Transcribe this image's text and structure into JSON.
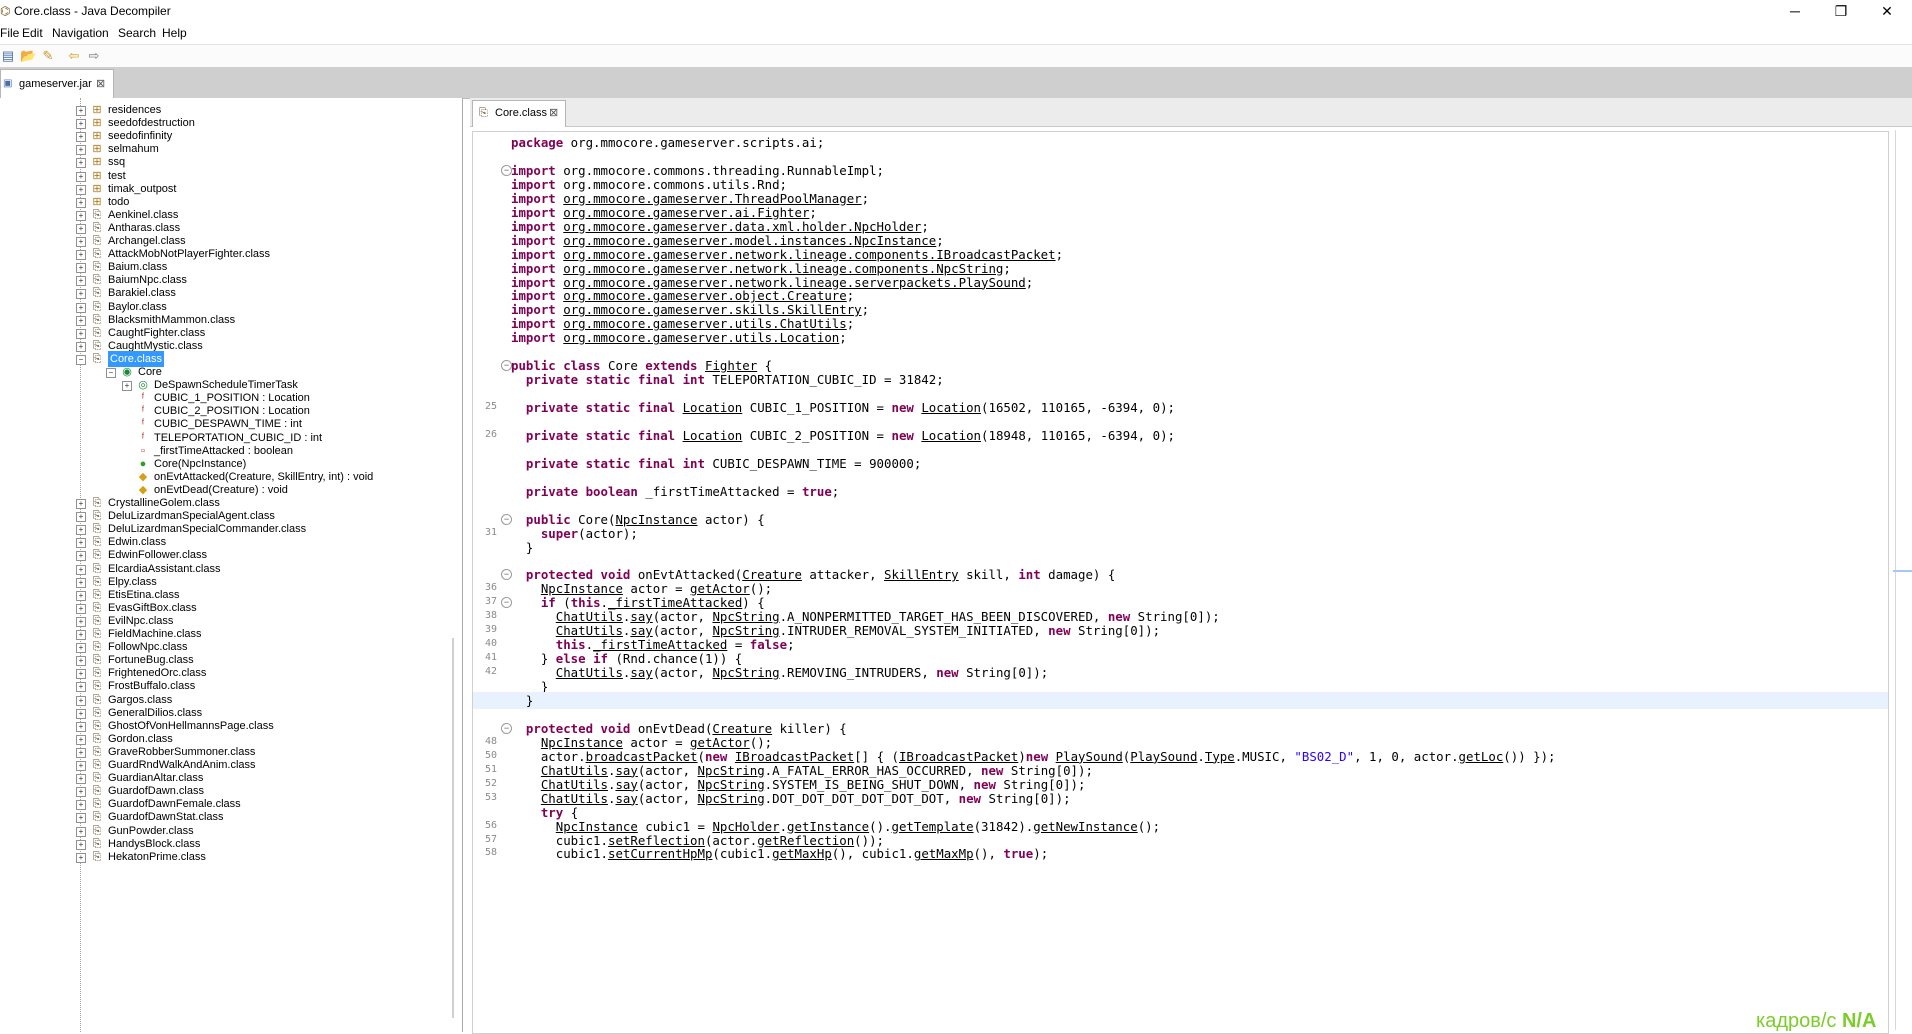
{
  "window": {
    "title": "Core.class - Java Decompiler",
    "controls": {
      "minimize": "─",
      "maximize": "❐",
      "close": "✕"
    }
  },
  "menu": [
    "File",
    "Edit",
    "Navigation",
    "Search",
    "Help"
  ],
  "toolbar": {
    "icons": [
      "open-file-icon",
      "open-type-icon",
      "reference-icon",
      "back-icon",
      "forward-icon"
    ],
    "glyphs": [
      "▤",
      "📂",
      "✎",
      "⇦",
      "⇨"
    ]
  },
  "jar_tab": {
    "label": "gameserver.jar",
    "close": "⊠"
  },
  "tree": {
    "items": [
      {
        "label": "residences",
        "type": "package",
        "depth": 0,
        "expander": "+"
      },
      {
        "label": "seedofdestruction",
        "type": "package",
        "depth": 0,
        "expander": "+"
      },
      {
        "label": "seedofinfinity",
        "type": "package",
        "depth": 0,
        "expander": "+"
      },
      {
        "label": "selmahum",
        "type": "package",
        "depth": 0,
        "expander": "+"
      },
      {
        "label": "ssq",
        "type": "package",
        "depth": 0,
        "expander": "+"
      },
      {
        "label": "test",
        "type": "package",
        "depth": 0,
        "expander": "+"
      },
      {
        "label": "timak_outpost",
        "type": "package",
        "depth": 0,
        "expander": "+"
      },
      {
        "label": "todo",
        "type": "package",
        "depth": 0,
        "expander": "+"
      },
      {
        "label": "Aenkinel.class",
        "type": "class",
        "depth": 0,
        "expander": "+"
      },
      {
        "label": "Antharas.class",
        "type": "class",
        "depth": 0,
        "expander": "+"
      },
      {
        "label": "Archangel.class",
        "type": "class",
        "depth": 0,
        "expander": "+"
      },
      {
        "label": "AttackMobNotPlayerFighter.class",
        "type": "class",
        "depth": 0,
        "expander": "+"
      },
      {
        "label": "Baium.class",
        "type": "class",
        "depth": 0,
        "expander": "+"
      },
      {
        "label": "BaiumNpc.class",
        "type": "class",
        "depth": 0,
        "expander": "+"
      },
      {
        "label": "Barakiel.class",
        "type": "class",
        "depth": 0,
        "expander": "+"
      },
      {
        "label": "Baylor.class",
        "type": "class",
        "depth": 0,
        "expander": "+"
      },
      {
        "label": "BlacksmithMammon.class",
        "type": "class",
        "depth": 0,
        "expander": "+"
      },
      {
        "label": "CaughtFighter.class",
        "type": "class",
        "depth": 0,
        "expander": "+"
      },
      {
        "label": "CaughtMystic.class",
        "type": "class",
        "depth": 0,
        "expander": "+"
      },
      {
        "label": "Core.class",
        "type": "class",
        "depth": 0,
        "expander": "−",
        "selected": true
      },
      {
        "label": "Core",
        "type": "type",
        "depth": 1,
        "expander": "−"
      },
      {
        "label": "DeSpawnScheduleTimerTask",
        "type": "inner",
        "depth": 2,
        "expander": "+"
      },
      {
        "label": "CUBIC_1_POSITION : Location",
        "type": "field-static",
        "depth": 2
      },
      {
        "label": "CUBIC_2_POSITION : Location",
        "type": "field-static",
        "depth": 2
      },
      {
        "label": "CUBIC_DESPAWN_TIME : int",
        "type": "field-static",
        "depth": 2
      },
      {
        "label": "TELEPORTATION_CUBIC_ID : int",
        "type": "field-static",
        "depth": 2
      },
      {
        "label": "_firstTimeAttacked : boolean",
        "type": "field",
        "depth": 2
      },
      {
        "label": "Core(NpcInstance)",
        "type": "ctor",
        "depth": 2
      },
      {
        "label": "onEvtAttacked(Creature, SkillEntry, int) : void",
        "type": "method",
        "depth": 2
      },
      {
        "label": "onEvtDead(Creature) : void",
        "type": "method",
        "depth": 2
      },
      {
        "label": "CrystallineGolem.class",
        "type": "class",
        "depth": 0,
        "expander": "+"
      },
      {
        "label": "DeluLizardmanSpecialAgent.class",
        "type": "class",
        "depth": 0,
        "expander": "+"
      },
      {
        "label": "DeluLizardmanSpecialCommander.class",
        "type": "class",
        "depth": 0,
        "expander": "+"
      },
      {
        "label": "Edwin.class",
        "type": "class",
        "depth": 0,
        "expander": "+"
      },
      {
        "label": "EdwinFollower.class",
        "type": "class",
        "depth": 0,
        "expander": "+"
      },
      {
        "label": "ElcardiaAssistant.class",
        "type": "class",
        "depth": 0,
        "expander": "+"
      },
      {
        "label": "Elpy.class",
        "type": "class",
        "depth": 0,
        "expander": "+"
      },
      {
        "label": "EtisEtina.class",
        "type": "class",
        "depth": 0,
        "expander": "+"
      },
      {
        "label": "EvasGiftBox.class",
        "type": "class",
        "depth": 0,
        "expander": "+"
      },
      {
        "label": "EvilNpc.class",
        "type": "class",
        "depth": 0,
        "expander": "+"
      },
      {
        "label": "FieldMachine.class",
        "type": "class",
        "depth": 0,
        "expander": "+"
      },
      {
        "label": "FollowNpc.class",
        "type": "class",
        "depth": 0,
        "expander": "+"
      },
      {
        "label": "FortuneBug.class",
        "type": "class",
        "depth": 0,
        "expander": "+"
      },
      {
        "label": "FrightenedOrc.class",
        "type": "class",
        "depth": 0,
        "expander": "+"
      },
      {
        "label": "FrostBuffalo.class",
        "type": "class",
        "depth": 0,
        "expander": "+"
      },
      {
        "label": "Gargos.class",
        "type": "class",
        "depth": 0,
        "expander": "+"
      },
      {
        "label": "GeneralDilios.class",
        "type": "class",
        "depth": 0,
        "expander": "+"
      },
      {
        "label": "GhostOfVonHellmannsPage.class",
        "type": "class",
        "depth": 0,
        "expander": "+"
      },
      {
        "label": "Gordon.class",
        "type": "class",
        "depth": 0,
        "expander": "+"
      },
      {
        "label": "GraveRobberSummoner.class",
        "type": "class",
        "depth": 0,
        "expander": "+"
      },
      {
        "label": "GuardRndWalkAndAnim.class",
        "type": "class",
        "depth": 0,
        "expander": "+"
      },
      {
        "label": "GuardianAltar.class",
        "type": "class",
        "depth": 0,
        "expander": "+"
      },
      {
        "label": "GuardofDawn.class",
        "type": "class",
        "depth": 0,
        "expander": "+"
      },
      {
        "label": "GuardofDawnFemale.class",
        "type": "class",
        "depth": 0,
        "expander": "+"
      },
      {
        "label": "GuardofDawnStat.class",
        "type": "class",
        "depth": 0,
        "expander": "+"
      },
      {
        "label": "GunPowder.class",
        "type": "class",
        "depth": 0,
        "expander": "+"
      },
      {
        "label": "HandysBlock.class",
        "type": "class",
        "depth": 0,
        "expander": "+"
      },
      {
        "label": "HekatonPrime.class",
        "type": "class",
        "depth": 0,
        "expander": "+"
      }
    ]
  },
  "editor_tab": {
    "label": "Core.class",
    "close": "⊠"
  },
  "code": {
    "lines": [
      {
        "n": "",
        "fold": "",
        "html": "<span class=\"kw\">package</span> org.mmocore.gameserver.scripts.ai;"
      },
      {
        "n": "",
        "fold": "",
        "html": ""
      },
      {
        "n": "",
        "fold": "−",
        "html": "<span class=\"kw\">import</span> org.mmocore.commons.threading.RunnableImpl;"
      },
      {
        "n": "",
        "fold": "",
        "html": "<span class=\"kw\">import</span> org.mmocore.commons.utils.Rnd;"
      },
      {
        "n": "",
        "fold": "",
        "html": "<span class=\"kw\">import</span> <span class=\"u\">org.mmocore.gameserver.ThreadPoolManager</span>;"
      },
      {
        "n": "",
        "fold": "",
        "html": "<span class=\"kw\">import</span> <span class=\"u\">org.mmocore.gameserver.ai.Fighter</span>;"
      },
      {
        "n": "",
        "fold": "",
        "html": "<span class=\"kw\">import</span> <span class=\"u\">org.mmocore.gameserver.data.xml.holder.NpcHolder</span>;"
      },
      {
        "n": "",
        "fold": "",
        "html": "<span class=\"kw\">import</span> <span class=\"u\">org.mmocore.gameserver.model.instances.NpcInstance</span>;"
      },
      {
        "n": "",
        "fold": "",
        "html": "<span class=\"kw\">import</span> <span class=\"u\">org.mmocore.gameserver.network.lineage.components.IBroadcastPacket</span>;"
      },
      {
        "n": "",
        "fold": "",
        "html": "<span class=\"kw\">import</span> <span class=\"u\">org.mmocore.gameserver.network.lineage.components.NpcString</span>;"
      },
      {
        "n": "",
        "fold": "",
        "html": "<span class=\"kw\">import</span> <span class=\"u\">org.mmocore.gameserver.network.lineage.serverpackets.PlaySound</span>;"
      },
      {
        "n": "",
        "fold": "",
        "html": "<span class=\"kw\">import</span> <span class=\"u\">org.mmocore.gameserver.object.Creature</span>;"
      },
      {
        "n": "",
        "fold": "",
        "html": "<span class=\"kw\">import</span> <span class=\"u\">org.mmocore.gameserver.skills.SkillEntry</span>;"
      },
      {
        "n": "",
        "fold": "",
        "html": "<span class=\"kw\">import</span> <span class=\"u\">org.mmocore.gameserver.utils.ChatUtils</span>;"
      },
      {
        "n": "",
        "fold": "",
        "html": "<span class=\"kw\">import</span> <span class=\"u\">org.mmocore.gameserver.utils.Location</span>;"
      },
      {
        "n": "",
        "fold": "",
        "html": ""
      },
      {
        "n": "",
        "fold": "−",
        "html": "<span class=\"kw\">public class</span> Core <span class=\"kw\">extends</span> <span class=\"u\">Fighter</span> {"
      },
      {
        "n": "",
        "fold": "",
        "html": "  <span class=\"kw\">private static final int</span> TELEPORTATION_CUBIC_ID = 31842;"
      },
      {
        "n": "",
        "fold": "",
        "html": ""
      },
      {
        "n": "25",
        "fold": "",
        "html": "  <span class=\"kw\">private static final</span> <span class=\"u\">Location</span> CUBIC_1_POSITION = <span class=\"kw\">new</span> <span class=\"u\">Location</span>(16502, 110165, -6394, 0);"
      },
      {
        "n": "",
        "fold": "",
        "html": ""
      },
      {
        "n": "26",
        "fold": "",
        "html": "  <span class=\"kw\">private static final</span> <span class=\"u\">Location</span> CUBIC_2_POSITION = <span class=\"kw\">new</span> <span class=\"u\">Location</span>(18948, 110165, -6394, 0);"
      },
      {
        "n": "",
        "fold": "",
        "html": ""
      },
      {
        "n": "",
        "fold": "",
        "html": "  <span class=\"kw\">private static final int</span> CUBIC_DESPAWN_TIME = 900000;"
      },
      {
        "n": "",
        "fold": "",
        "html": ""
      },
      {
        "n": "",
        "fold": "",
        "html": "  <span class=\"kw\">private boolean</span> _firstTimeAttacked = <span class=\"kw\">true</span>;"
      },
      {
        "n": "",
        "fold": "",
        "html": ""
      },
      {
        "n": "",
        "fold": "−",
        "html": "  <span class=\"kw\">public</span> Core(<span class=\"u\">NpcInstance</span> actor) {"
      },
      {
        "n": "31",
        "fold": "",
        "html": "    <span class=\"kw\">super</span>(actor);"
      },
      {
        "n": "",
        "fold": "",
        "html": "  }"
      },
      {
        "n": "",
        "fold": "",
        "html": ""
      },
      {
        "n": "",
        "fold": "−",
        "html": "  <span class=\"kw\">protected void</span> onEvtAttacked(<span class=\"u\">Creature</span> attacker, <span class=\"u\">SkillEntry</span> skill, <span class=\"kw\">int</span> damage) {"
      },
      {
        "n": "36",
        "fold": "",
        "html": "    <span class=\"u\">NpcInstance</span> actor = <span class=\"u\">getActor</span>();"
      },
      {
        "n": "37",
        "fold": "−",
        "html": "    <span class=\"kw\">if</span> (<span class=\"kw\">this</span>.<span class=\"u\">_firstTimeAttacked</span>) {"
      },
      {
        "n": "38",
        "fold": "",
        "html": "      <span class=\"u\">ChatUtils</span>.<span class=\"u\">say</span>(actor, <span class=\"u\">NpcString</span>.A_NONPERMITTED_TARGET_HAS_BEEN_DISCOVERED, <span class=\"kw\">new</span> String[0]);"
      },
      {
        "n": "39",
        "fold": "",
        "html": "      <span class=\"u\">ChatUtils</span>.<span class=\"u\">say</span>(actor, <span class=\"u\">NpcString</span>.INTRUDER_REMOVAL_SYSTEM_INITIATED, <span class=\"kw\">new</span> String[0]);"
      },
      {
        "n": "40",
        "fold": "",
        "html": "      <span class=\"kw\">this</span>.<span class=\"u\">_firstTimeAttacked</span> = <span class=\"kw\">false</span>;"
      },
      {
        "n": "41",
        "fold": "",
        "html": "    } <span class=\"kw\">else if</span> (Rnd.chance(1)) {"
      },
      {
        "n": "42",
        "fold": "",
        "html": "      <span class=\"u\">ChatUtils</span>.<span class=\"u\">say</span>(actor, <span class=\"u\">NpcString</span>.REMOVING_INTRUDERS, <span class=\"kw\">new</span> String[0]);"
      },
      {
        "n": "",
        "fold": "",
        "html": "    }"
      },
      {
        "n": "",
        "fold": "",
        "html": "  }",
        "highlight": true
      },
      {
        "n": "",
        "fold": "",
        "html": ""
      },
      {
        "n": "",
        "fold": "−",
        "html": "  <span class=\"kw\">protected void</span> onEvtDead(<span class=\"u\">Creature</span> killer) {"
      },
      {
        "n": "48",
        "fold": "",
        "html": "    <span class=\"u\">NpcInstance</span> actor = <span class=\"u\">getActor</span>();"
      },
      {
        "n": "50",
        "fold": "",
        "html": "    actor.<span class=\"u\">broadcastPacket</span>(<span class=\"kw\">new</span> <span class=\"u\">IBroadcastPacket</span>[] { (<span class=\"u\">IBroadcastPacket</span>)<span class=\"kw\">new</span> <span class=\"u\">PlaySound</span>(<span class=\"u\">PlaySound</span>.<span class=\"u\">Type</span>.MUSIC, <span class=\"str\">\"BS02_D\"</span>, 1, 0, actor.<span class=\"u\">getLoc</span>()) });"
      },
      {
        "n": "51",
        "fold": "",
        "html": "    <span class=\"u\">ChatUtils</span>.<span class=\"u\">say</span>(actor, <span class=\"u\">NpcString</span>.A_FATAL_ERROR_HAS_OCCURRED, <span class=\"kw\">new</span> String[0]);"
      },
      {
        "n": "52",
        "fold": "",
        "html": "    <span class=\"u\">ChatUtils</span>.<span class=\"u\">say</span>(actor, <span class=\"u\">NpcString</span>.SYSTEM_IS_BEING_SHUT_DOWN, <span class=\"kw\">new</span> String[0]);"
      },
      {
        "n": "53",
        "fold": "",
        "html": "    <span class=\"u\">ChatUtils</span>.<span class=\"u\">say</span>(actor, <span class=\"u\">NpcString</span>.DOT_DOT_DOT_DOT_DOT_DOT, <span class=\"kw\">new</span> String[0]);"
      },
      {
        "n": "",
        "fold": "",
        "html": "    <span class=\"kw\">try</span> {"
      },
      {
        "n": "56",
        "fold": "",
        "html": "      <span class=\"u\">NpcInstance</span> cubic1 = <span class=\"u\">NpcHolder</span>.<span class=\"u\">getInstance</span>().<span class=\"u\">getTemplate</span>(31842).<span class=\"u\">getNewInstance</span>();"
      },
      {
        "n": "57",
        "fold": "",
        "html": "      cubic1.<span class=\"u\">setReflection</span>(actor.<span class=\"u\">getReflection</span>());"
      },
      {
        "n": "58",
        "fold": "",
        "html": "      cubic1.<span class=\"u\">setCurrentHpMp</span>(cubic1.<span class=\"u\">getMaxHp</span>(), cubic1.<span class=\"u\">getMaxMp</span>(), <span class=\"kw\">true</span>);"
      }
    ]
  },
  "watermark": {
    "text": "кадров/с ",
    "value": "N/A"
  }
}
